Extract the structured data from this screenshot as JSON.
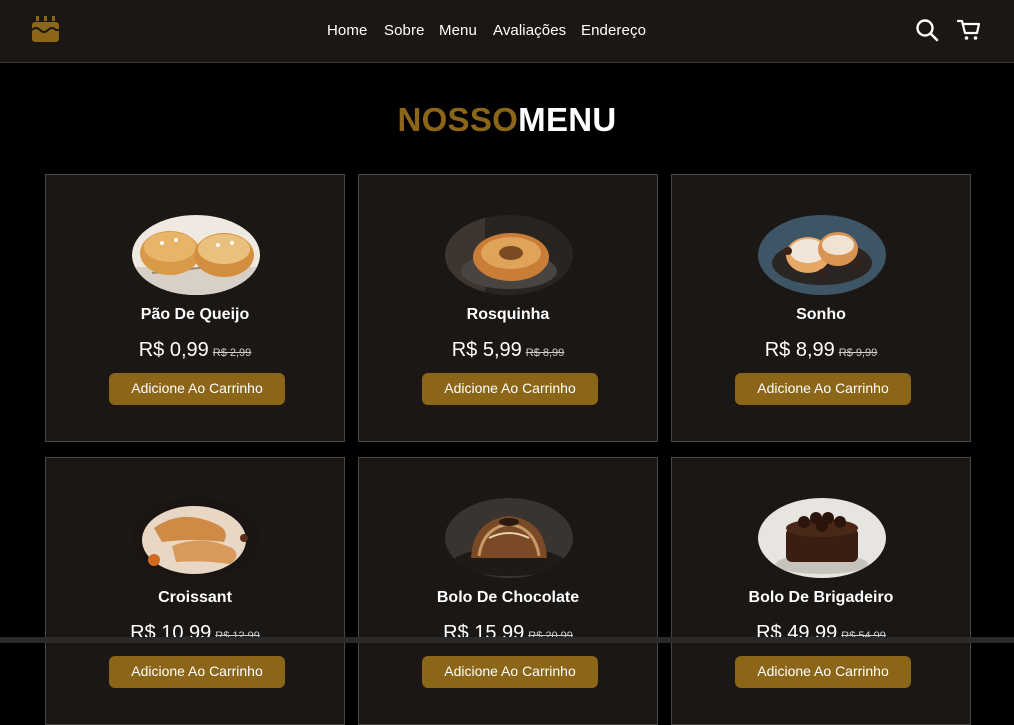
{
  "nav": {
    "home": "Home",
    "sobre": "Sobre",
    "menu": "Menu",
    "avaliacoes": "Avaliações",
    "endereco": "Endereço"
  },
  "icons": {
    "logo": "cake-logo-icon",
    "search": "search-icon",
    "cart": "cart-icon"
  },
  "title": {
    "part1": "NOSSO",
    "part2": "MENU"
  },
  "colors": {
    "accent": "#8b6518",
    "card_bg": "#1a1714",
    "page_bg": "#000000"
  },
  "products": [
    {
      "name": "Pão De Queijo",
      "price": "R$ 0,99",
      "old_price": "R$ 2,99",
      "button": "Adicione Ao Carrinho"
    },
    {
      "name": "Rosquinha",
      "price": "R$ 5,99",
      "old_price": "R$ 8,99",
      "button": "Adicione Ao Carrinho"
    },
    {
      "name": "Sonho",
      "price": "R$ 8,99",
      "old_price": "R$ 9,99",
      "button": "Adicione Ao Carrinho"
    },
    {
      "name": "Croissant",
      "price": "R$ 10,99",
      "old_price": "R$ 12,99",
      "button": "Adicione Ao Carrinho"
    },
    {
      "name": "Bolo De Chocolate",
      "price": "R$ 15,99",
      "old_price": "R$ 20,99",
      "button": "Adicione Ao Carrinho"
    },
    {
      "name": "Bolo De Brigadeiro",
      "price": "R$ 49,99",
      "old_price": "R$ 54,99",
      "button": "Adicione Ao Carrinho"
    }
  ]
}
